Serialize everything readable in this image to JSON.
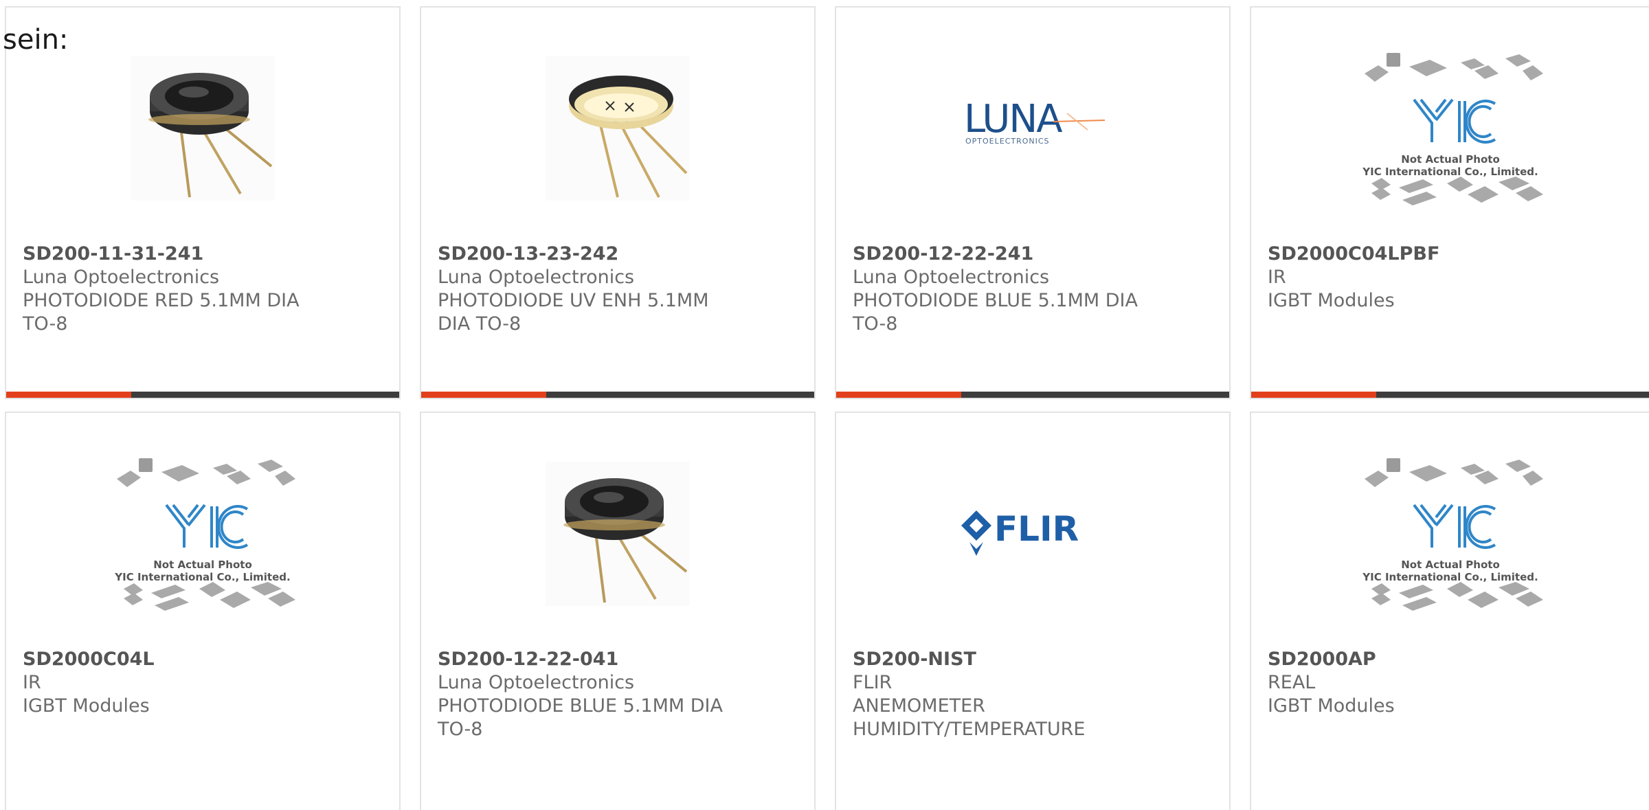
{
  "page": {
    "lead_text": "sein:"
  },
  "colors": {
    "accent": "#e2401c",
    "bar": "#3d3d3d",
    "card_border": "#e3e3e3",
    "text": "#6b6b6b",
    "luna_blue": "#1d4f8b",
    "flir_blue": "#1f5fa8",
    "yic_blue": "#2f86c8"
  },
  "products": [
    {
      "part_number": "SD200-11-31-241",
      "manufacturer": "Luna Optoelectronics",
      "description": "PHOTODIODE RED 5.1MM DIA\nTO-8",
      "image": "photodiode-can-side-icon",
      "has_accent_bar": true
    },
    {
      "part_number": "SD200-13-23-242",
      "manufacturer": "Luna Optoelectronics",
      "description": "PHOTODIODE UV ENH 5.1MM\nDIA TO-8",
      "image": "photodiode-can-top-icon",
      "has_accent_bar": true
    },
    {
      "part_number": "SD200-12-22-241",
      "manufacturer": "Luna Optoelectronics",
      "description": "PHOTODIODE BLUE 5.1MM DIA\nTO-8",
      "image": "luna-logo",
      "logo_text": "LUNA",
      "logo_subtext": "OPTOELECTRONICS",
      "has_accent_bar": true
    },
    {
      "part_number": "SD2000C04LPBF",
      "manufacturer": "IR",
      "description": "IGBT Modules",
      "image": "yic-placeholder",
      "placeholder_line1": "Not Actual Photo",
      "placeholder_line2": "YIC International Co., Limited.",
      "has_accent_bar": true
    },
    {
      "part_number": "SD2000C04L",
      "manufacturer": "IR",
      "description": "IGBT Modules",
      "image": "yic-placeholder",
      "placeholder_line1": "Not Actual Photo",
      "placeholder_line2": "YIC International Co., Limited.",
      "has_accent_bar": false
    },
    {
      "part_number": "SD200-12-22-041",
      "manufacturer": "Luna Optoelectronics",
      "description": "PHOTODIODE BLUE 5.1MM DIA\nTO-8",
      "image": "photodiode-can-side-icon",
      "has_accent_bar": false
    },
    {
      "part_number": "SD200-NIST",
      "manufacturer": "FLIR",
      "description": "ANEMOMETER\nHUMIDITY/TEMPERATURE",
      "image": "flir-logo",
      "logo_text": "FLIR",
      "has_accent_bar": false
    },
    {
      "part_number": "SD2000AP",
      "manufacturer": "REAL",
      "description": "IGBT Modules",
      "image": "yic-placeholder",
      "placeholder_line1": "Not Actual Photo",
      "placeholder_line2": "YIC International Co., Limited.",
      "has_accent_bar": false
    }
  ]
}
